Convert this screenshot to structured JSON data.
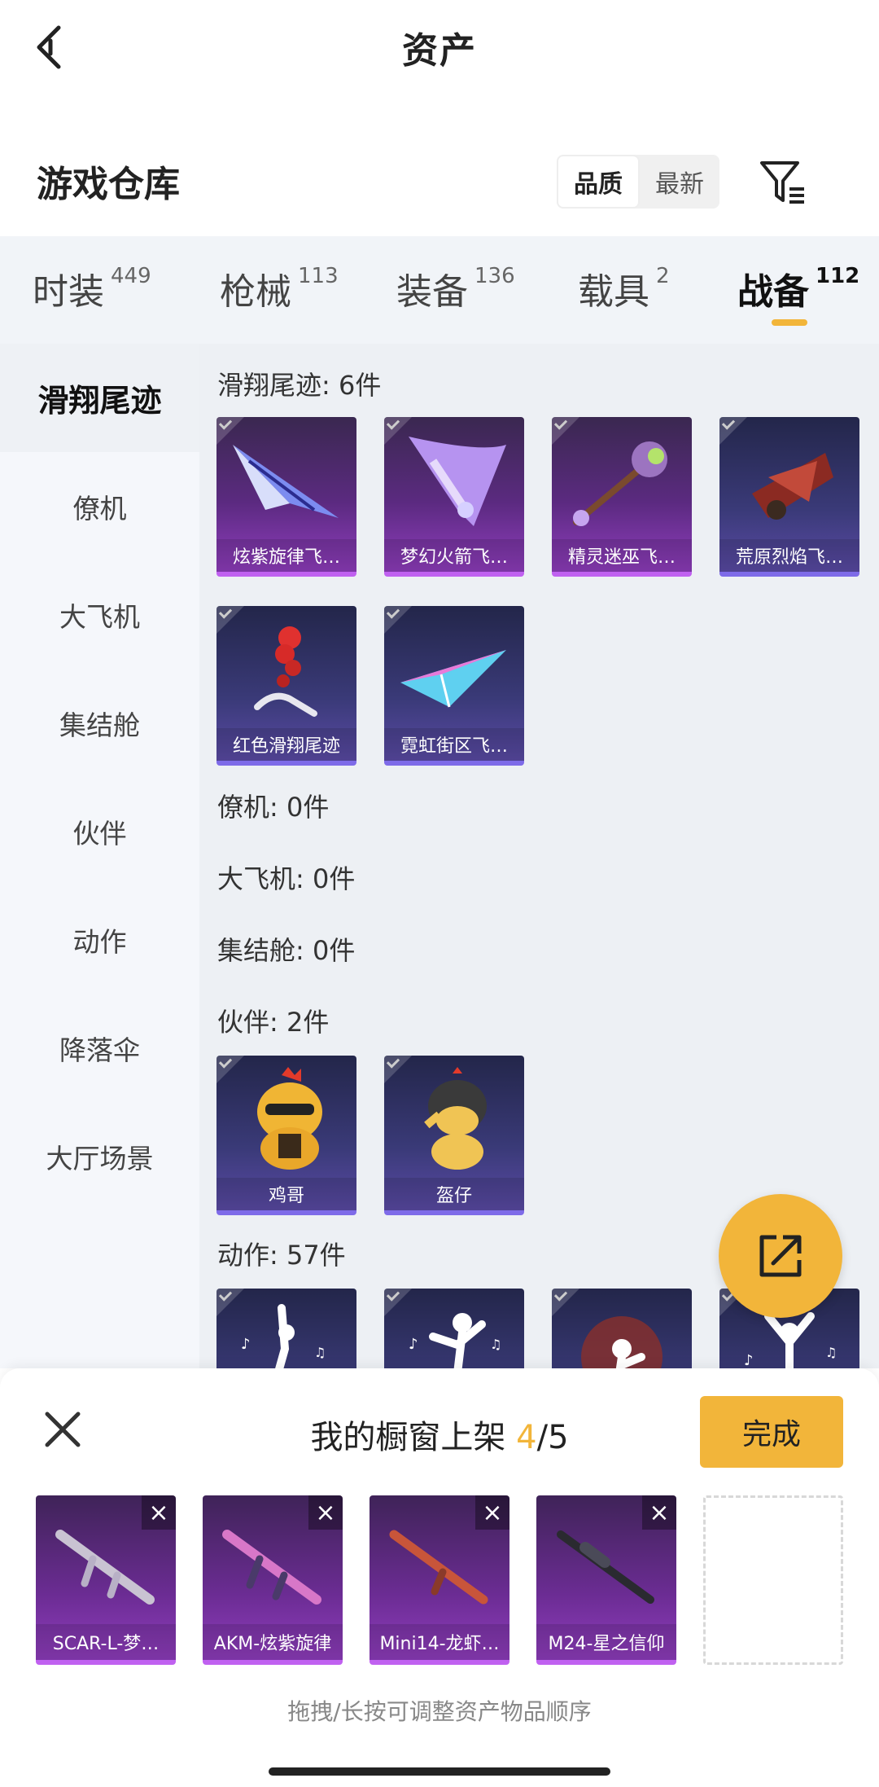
{
  "header": {
    "title": "资产"
  },
  "warehouse": {
    "title": "游戏仓库",
    "sort_options": [
      "品质",
      "最新"
    ],
    "sort_active": "品质"
  },
  "tabs": [
    {
      "label": "时装",
      "count": "449"
    },
    {
      "label": "枪械",
      "count": "113"
    },
    {
      "label": "装备",
      "count": "136"
    },
    {
      "label": "载具",
      "count": "2"
    },
    {
      "label": "战备",
      "count": "112",
      "active": true
    }
  ],
  "sidebar": [
    {
      "label": "滑翔尾迹",
      "active": true
    },
    {
      "label": "僚机"
    },
    {
      "label": "大飞机"
    },
    {
      "label": "集结舱"
    },
    {
      "label": "伙伴"
    },
    {
      "label": "动作"
    },
    {
      "label": "降落伞"
    },
    {
      "label": "大厅场景"
    }
  ],
  "sections": {
    "glide": {
      "title": "滑翔尾迹: 6件",
      "items": [
        "炫紫旋律飞…",
        "梦幻火箭飞…",
        "精灵迷巫飞…",
        "荒原烈焰飞…",
        "红色滑翔尾迹",
        "霓虹街区飞…"
      ]
    },
    "wingman": {
      "title": "僚机: 0件"
    },
    "plane": {
      "title": "大飞机: 0件"
    },
    "pod": {
      "title": "集结舱: 0件"
    },
    "partner": {
      "title": "伙伴: 2件",
      "items": [
        "鸡哥",
        "盔仔"
      ]
    },
    "emote": {
      "title": "动作: 57件"
    }
  },
  "showcase": {
    "title_prefix": "我的橱窗上架 ",
    "current": "4",
    "total": "/5",
    "done_label": "完成",
    "items": [
      "SCAR-L-梦…",
      "AKM-炫紫旋律",
      "Mini14-龙虾…",
      "M24-星之信仰"
    ],
    "hint": "拖拽/长按可调整资产物品顺序"
  },
  "colors": {
    "accent": "#f2b53a",
    "purple_quality": "#c061f0",
    "blue_quality": "#7e6be8"
  }
}
